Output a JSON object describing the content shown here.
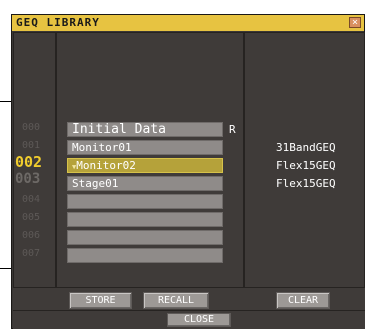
{
  "window": {
    "title": "GEQ LIBRARY",
    "close_glyph": "×"
  },
  "list": {
    "numbers": [
      "000",
      "001",
      "002",
      "003",
      "004",
      "005",
      "006",
      "007"
    ],
    "items": [
      {
        "name": "Initial Data",
        "type": "",
        "flag": "R"
      },
      {
        "name": "Monitor01",
        "type": "31BandGEQ"
      },
      {
        "name": "Monitor02",
        "type": "Flex15GEQ",
        "selected": true
      },
      {
        "name": "Stage01",
        "type": "Flex15GEQ"
      },
      {
        "name": "",
        "type": ""
      },
      {
        "name": "",
        "type": ""
      },
      {
        "name": "",
        "type": ""
      },
      {
        "name": "",
        "type": ""
      }
    ],
    "selected_marker": "▼"
  },
  "buttons": {
    "store": "STORE",
    "recall": "RECALL",
    "clear": "CLEAR",
    "close": "CLOSE"
  },
  "colors": {
    "title_bar": "#e7c341",
    "selected_item": "#b5a23a",
    "selected_number": "#f1cd2d"
  }
}
